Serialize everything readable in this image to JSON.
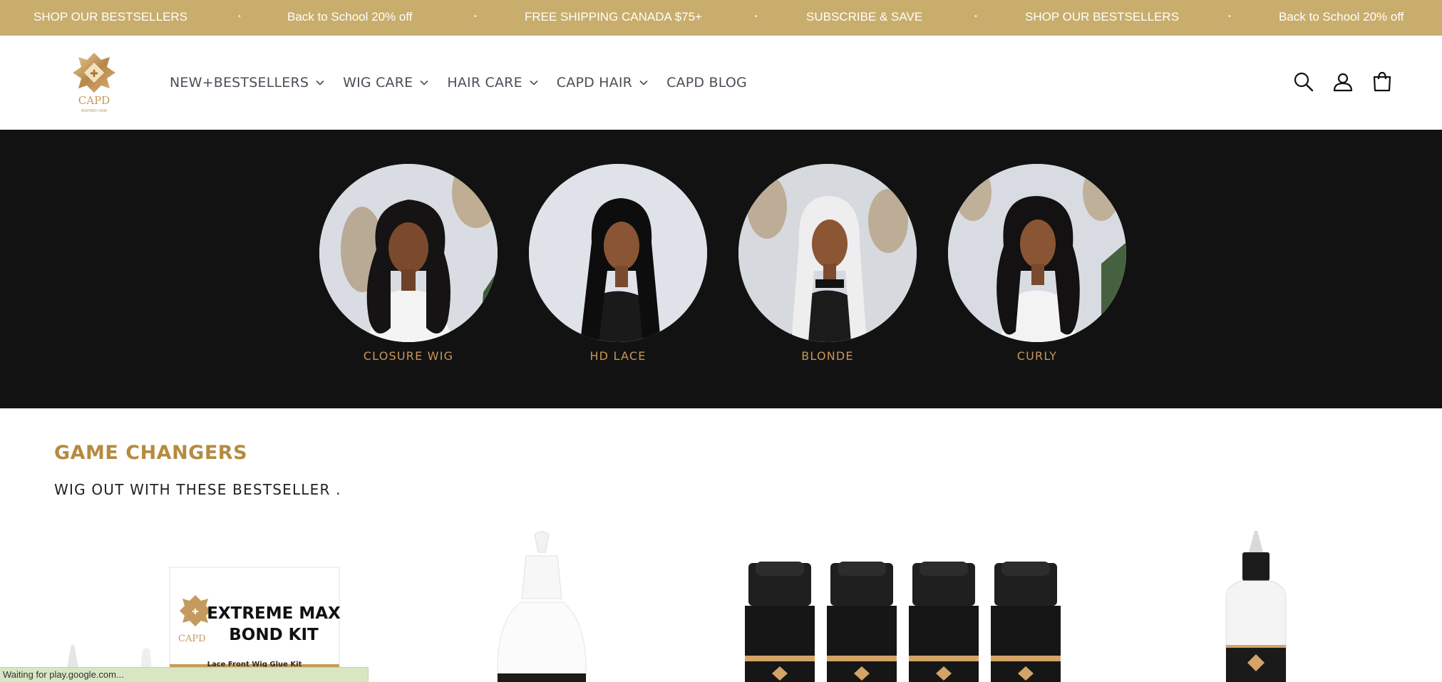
{
  "announcement": {
    "messages": [
      "SHOP OUR BESTSELLERS",
      "Back to School 20% off",
      "FREE SHIPPING CANADA $75+",
      "SUBSCRIBE & SAVE",
      "SHOP OUR BESTSELLERS",
      "Back to School 20% off"
    ],
    "separator": "•",
    "background": "#c9ad6c"
  },
  "header": {
    "logo_text": "CAPD",
    "logo_subtext": "INSPIRED HAIR",
    "nav": [
      {
        "label": "NEW+BESTSELLERS",
        "has_dropdown": true
      },
      {
        "label": "WIG CARE",
        "has_dropdown": true
      },
      {
        "label": "HAIR CARE",
        "has_dropdown": true
      },
      {
        "label": "CAPD HAIR",
        "has_dropdown": true
      },
      {
        "label": "CAPD BLOG",
        "has_dropdown": false
      }
    ],
    "icons": [
      "search-icon",
      "account-icon",
      "cart-icon"
    ]
  },
  "categories": [
    {
      "label": "CLOSURE WIG",
      "hair": "wavy-black"
    },
    {
      "label": "HD LACE",
      "hair": "straight-black"
    },
    {
      "label": "BLONDE",
      "hair": "straight-platinum"
    },
    {
      "label": "CURLY",
      "hair": "curly-black"
    }
  ],
  "section": {
    "title": "GAME CHANGERS",
    "subtitle": "WIG OUT WITH THESE BESTSELLER ."
  },
  "products": [
    {
      "box_title_line1": "EXTREME MAX",
      "box_title_line2": "BOND KIT",
      "box_subtitle": "Lace Front Wig Glue Kit",
      "brand": "CAPD"
    },
    {
      "name": "glue-bottle"
    },
    {
      "name": "foam-pack"
    },
    {
      "name": "applicator-bottle"
    }
  ],
  "status_bar": {
    "text": "Waiting for play.google.com..."
  },
  "colors": {
    "gold": "#c9ad6c",
    "title_gold": "#b58b3d",
    "caption": "#c9965a",
    "strip": "#121212"
  }
}
